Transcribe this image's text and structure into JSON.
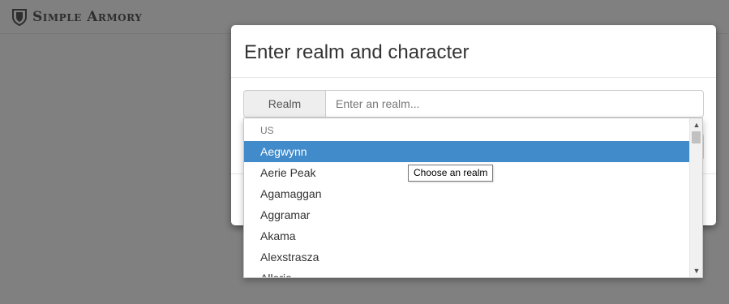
{
  "header": {
    "brand": "Simple Armory",
    "logo_icon": "shield-icon"
  },
  "modal": {
    "title": "Enter realm and character",
    "realm_addon": "Realm",
    "realm_input": {
      "value": "",
      "placeholder": "Enter an realm..."
    }
  },
  "dropdown": {
    "group": "US",
    "options": [
      "Aegwynn",
      "Aerie Peak",
      "Agamaggan",
      "Aggramar",
      "Akama",
      "Alexstrasza",
      "Alleria"
    ],
    "active_index": 0
  },
  "tooltip": "Choose an realm",
  "colors": {
    "overlay": "#808080",
    "active_option": "#428bca",
    "primary_button": "#337ab7"
  }
}
